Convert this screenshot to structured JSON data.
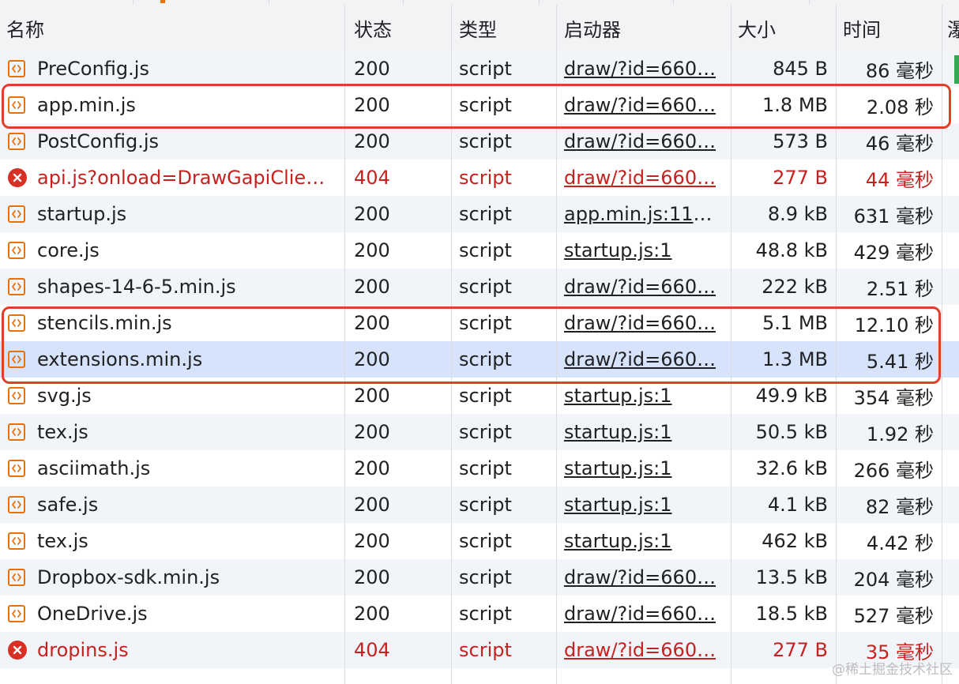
{
  "columns": {
    "name": "名称",
    "status": "状态",
    "type": "类型",
    "initiator": "启动器",
    "size": "大小",
    "time": "时间",
    "extra": "瀑"
  },
  "rows": [
    {
      "name": "PreConfig.js",
      "status": "200",
      "type": "script",
      "initiator": "draw/?id=660…",
      "size": "845 B",
      "time": "86 毫秒",
      "error": false
    },
    {
      "name": "app.min.js",
      "status": "200",
      "type": "script",
      "initiator": "draw/?id=660…",
      "size": "1.8 MB",
      "time": "2.08 秒",
      "error": false
    },
    {
      "name": "PostConfig.js",
      "status": "200",
      "type": "script",
      "initiator": "draw/?id=660…",
      "size": "573 B",
      "time": "46 毫秒",
      "error": false
    },
    {
      "name": "api.js?onload=DrawGapiClie…",
      "status": "404",
      "type": "script",
      "initiator": "draw/?id=660…",
      "size": "277 B",
      "time": "44 毫秒",
      "error": true
    },
    {
      "name": "startup.js",
      "status": "200",
      "type": "script",
      "initiator": "app.min.js:118…",
      "size": "8.9 kB",
      "time": "631 毫秒",
      "error": false
    },
    {
      "name": "core.js",
      "status": "200",
      "type": "script",
      "initiator": "startup.js:1",
      "size": "48.8 kB",
      "time": "429 毫秒",
      "error": false
    },
    {
      "name": "shapes-14-6-5.min.js",
      "status": "200",
      "type": "script",
      "initiator": "draw/?id=660…",
      "size": "222 kB",
      "time": "2.51 秒",
      "error": false
    },
    {
      "name": "stencils.min.js",
      "status": "200",
      "type": "script",
      "initiator": "draw/?id=660…",
      "size": "5.1 MB",
      "time": "12.10 秒",
      "error": false
    },
    {
      "name": "extensions.min.js",
      "status": "200",
      "type": "script",
      "initiator": "draw/?id=660…",
      "size": "1.3 MB",
      "time": "5.41 秒",
      "error": false,
      "selected": true
    },
    {
      "name": "svg.js",
      "status": "200",
      "type": "script",
      "initiator": "startup.js:1",
      "size": "49.9 kB",
      "time": "354 毫秒",
      "error": false
    },
    {
      "name": "tex.js",
      "status": "200",
      "type": "script",
      "initiator": "startup.js:1",
      "size": "50.5 kB",
      "time": "1.92 秒",
      "error": false
    },
    {
      "name": "asciimath.js",
      "status": "200",
      "type": "script",
      "initiator": "startup.js:1",
      "size": "32.6 kB",
      "time": "266 毫秒",
      "error": false
    },
    {
      "name": "safe.js",
      "status": "200",
      "type": "script",
      "initiator": "startup.js:1",
      "size": "4.1 kB",
      "time": "82 毫秒",
      "error": false
    },
    {
      "name": "tex.js",
      "status": "200",
      "type": "script",
      "initiator": "startup.js:1",
      "size": "462 kB",
      "time": "4.42 秒",
      "error": false
    },
    {
      "name": "Dropbox-sdk.min.js",
      "status": "200",
      "type": "script",
      "initiator": "draw/?id=660…",
      "size": "13.5 kB",
      "time": "204 毫秒",
      "error": false
    },
    {
      "name": "OneDrive.js",
      "status": "200",
      "type": "script",
      "initiator": "draw/?id=660…",
      "size": "18.5 kB",
      "time": "527 毫秒",
      "error": false
    },
    {
      "name": "dropins.js",
      "status": "404",
      "type": "script",
      "initiator": "draw/?id=660…",
      "size": "277 B",
      "time": "35 毫秒",
      "error": true
    }
  ],
  "colors": {
    "error_text": "#c5221f",
    "error_icon": "#d93025",
    "js_icon": "#e8710a",
    "highlight_box": "#e0402b",
    "selected_row": "#d6e3fa",
    "stripe_row": "#f1f4f9"
  },
  "icons": {
    "script": "js-file-icon",
    "error": "error-circle-icon"
  },
  "watermark": "@稀土掘金技术社区"
}
